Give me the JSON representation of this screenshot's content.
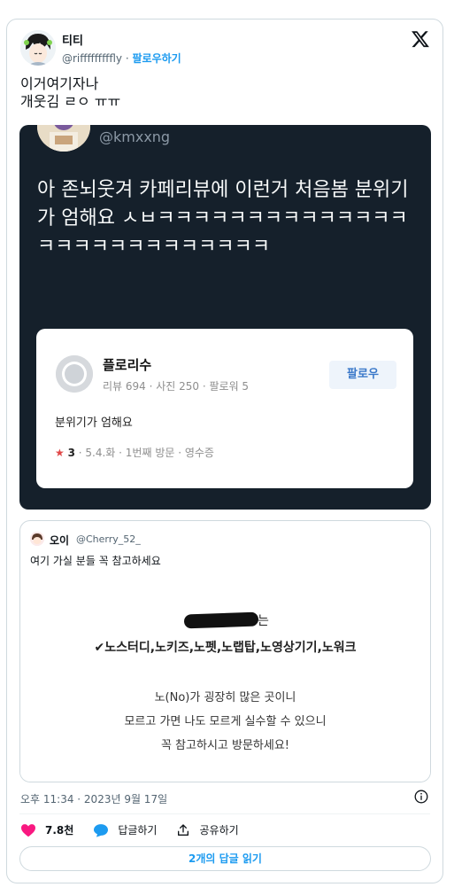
{
  "tweet": {
    "display_name": "티티",
    "handle": "@rifffffffffly",
    "separator": "·",
    "follow_label": "팔로우하기",
    "text_line1": "이거여기자나",
    "text_line2": "개웃김 ㄹㅇ ㅠㅠ",
    "logo_icon": "x-logo-icon"
  },
  "embedded_screenshot": {
    "handle": "@kmxxng",
    "text": "아 존뇌웃겨 카페리뷰에 이런거 처음봄 분위기가 엄해요 ㅅㅂㅋㅋㅋㅋㅋㅋㅋㅋㅋㅋㅋㅋㅋㅋㅋㅋㅋㅋㅋㅋㅋㅋㅋㅋㅋㅋㅋ",
    "review": {
      "name": "플로리수",
      "stats": "리뷰 694 · 사진 250 · 팔로워 5",
      "follow_label": "팔로우",
      "body": "분위기가 엄해요",
      "star": "★",
      "score": "3",
      "meta": "· 5.4.화 · 1번째 방문 · 영수증"
    }
  },
  "quote": {
    "name": "오이",
    "handle": "@Cherry_52_",
    "text": "여기 가실 분들 꼭 참고하세요",
    "image": {
      "redact_suffix": "는",
      "rules": "✔노스터디,노키즈,노펫,노랩탑,노영상기기,노워크",
      "notice1": "노(No)가 굉장히 많은 곳이니",
      "notice2": "모르고 가면 나도 모르게 실수할 수 있으니",
      "notice3": "꼭 참고하시고 방문하세요!"
    }
  },
  "footer": {
    "timestamp": "오후 11:34 · 2023년 9월 17일",
    "likes": "7.8천",
    "reply_label": "답글하기",
    "share_label": "공유하기",
    "read_replies": "2개의 답글 읽기"
  },
  "colors": {
    "accent": "#1d9bf0",
    "like": "#f91880",
    "dark_bg": "#15202b"
  }
}
